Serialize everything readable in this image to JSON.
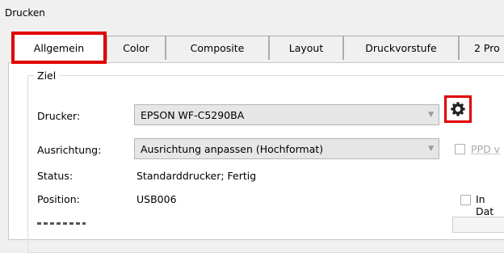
{
  "window": {
    "title": "Drucken"
  },
  "tabs": [
    {
      "label": "Allgemein"
    },
    {
      "label": "Color"
    },
    {
      "label": "Composite"
    },
    {
      "label": "Layout"
    },
    {
      "label": "Druckvorstufe"
    },
    {
      "label": "2 Pro"
    }
  ],
  "target_group": {
    "title": "Ziel"
  },
  "printer": {
    "label": "Drucker:",
    "value": "EPSON WF-C5290BA"
  },
  "orientation": {
    "label": "Ausrichtung:",
    "value": "Ausrichtung anpassen (Hochformat)"
  },
  "ppd_option": {
    "label": "PPD v"
  },
  "status": {
    "label": "Status:",
    "value": "Standarddrucker; Fertig"
  },
  "position": {
    "label": "Position:",
    "value": "USB006"
  },
  "in_file_option": {
    "label": "In Dat"
  },
  "icons": {
    "settings": "gear-icon",
    "dropdown": "chevron-down-icon"
  },
  "colors": {
    "highlight": "#e00000",
    "panel": "#ffffff",
    "chrome": "#f0f0f0"
  }
}
